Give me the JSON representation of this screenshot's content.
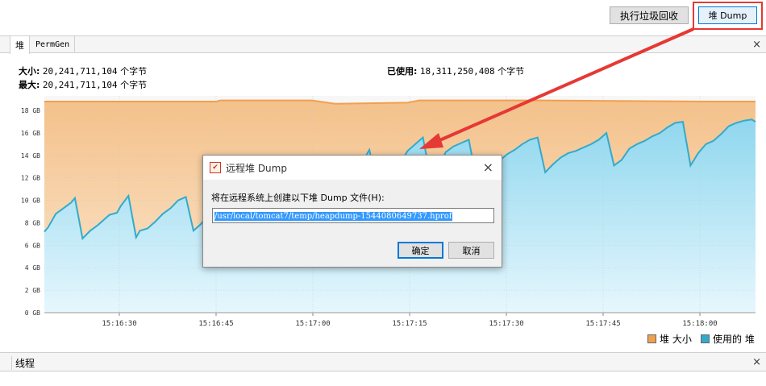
{
  "toolbar": {
    "gc_label": "执行垃圾回收",
    "heap_dump_label": "堆 Dump"
  },
  "tabs": [
    {
      "label": "堆"
    },
    {
      "label": "PermGen"
    }
  ],
  "close_glyph": "×",
  "heap_stats": {
    "size_label": "大小:",
    "size_value": "20,241,711,104",
    "max_label": "最大:",
    "max_value": "20,241,711,104",
    "used_label": "已使用:",
    "used_value": "18,311,250,408",
    "unit": "个字节"
  },
  "chart_data": {
    "type": "area",
    "ylim": [
      0,
      19.3
    ],
    "y_ticks": [
      "0 GB",
      "2 GB",
      "4 GB",
      "6 GB",
      "8 GB",
      "10 GB",
      "12 GB",
      "14 GB",
      "16 GB",
      "18 GB"
    ],
    "x_ticks": [
      "15:16:30",
      "15:16:45",
      "15:17:00",
      "15:17:15",
      "15:17:30",
      "15:17:45",
      "15:18:00"
    ],
    "colors": {
      "heap": "#f0a050",
      "used": "#33aacc"
    },
    "series": [
      {
        "name": "堆 大小",
        "t": [
          0,
          45,
          46,
          70,
          76,
          95,
          98,
          130,
          175,
          186
        ],
        "values": [
          18.8,
          18.8,
          18.9,
          18.9,
          18.6,
          18.7,
          18.9,
          18.9,
          18.8,
          18.8
        ]
      },
      {
        "name": "使用的 堆",
        "t": [
          0,
          1,
          3,
          5,
          7,
          8,
          10,
          12,
          14,
          15,
          17,
          19,
          20,
          22,
          24,
          25,
          27,
          29,
          31,
          33,
          35,
          37,
          39,
          41,
          43,
          45,
          47,
          49,
          51,
          53,
          55,
          57,
          59,
          62,
          63,
          64,
          65,
          66,
          67,
          68,
          70,
          72,
          74,
          75,
          77,
          79,
          81,
          83,
          85,
          87,
          89,
          91,
          93,
          95,
          97,
          99,
          101,
          103,
          105,
          107,
          109,
          111,
          113,
          115,
          117,
          119,
          121,
          123,
          125,
          127,
          129,
          131,
          133,
          135,
          137,
          139,
          141,
          143,
          145,
          147,
          149,
          151,
          153,
          155,
          157,
          159,
          161,
          163,
          165,
          167,
          169,
          171,
          173,
          175,
          177,
          179,
          181,
          183,
          185,
          186
        ],
        "values": [
          7.2,
          7.6,
          8.8,
          9.3,
          9.8,
          10.2,
          6.6,
          7.3,
          7.8,
          8.1,
          8.7,
          8.9,
          9.5,
          10.4,
          6.7,
          7.3,
          7.5,
          8.1,
          8.8,
          9.3,
          10.0,
          10.3,
          7.3,
          7.9,
          8.9,
          9.9,
          10.3,
          10.6,
          11.0,
          11.5,
          11.8,
          12.0,
          12.3,
          12.4,
          12.5,
          12.6,
          12.8,
          13.0,
          13.3,
          13.6,
          11.4,
          12.0,
          12.4,
          12.8,
          13.2,
          11.3,
          12.3,
          13.3,
          14.5,
          11.4,
          12.6,
          13.0,
          13.3,
          14.4,
          15.0,
          15.6,
          12.1,
          13.0,
          14.3,
          14.8,
          15.1,
          15.4,
          11.9,
          12.6,
          13.1,
          13.5,
          14.1,
          14.5,
          15.0,
          15.4,
          15.6,
          12.5,
          13.2,
          13.8,
          14.2,
          14.4,
          14.7,
          15.0,
          15.4,
          16.0,
          13.1,
          13.6,
          14.6,
          15.0,
          15.3,
          15.7,
          16.0,
          16.5,
          16.9,
          17.0,
          13.1,
          14.2,
          15.0,
          15.3,
          15.9,
          16.6,
          16.9,
          17.1,
          17.2,
          17.0
        ]
      }
    ]
  },
  "legend": {
    "heap_label": "堆 大小",
    "used_label": "使用的 堆"
  },
  "threads_section": {
    "title": "线程"
  },
  "dialog": {
    "title": "远程堆 Dump",
    "prompt": "将在远程系统上创建以下堆 Dump 文件(H):",
    "path_value": "/usr/local/tomcat7/temp/heapdump-1544080649737.hprof",
    "ok_label": "确定",
    "cancel_label": "取消"
  }
}
